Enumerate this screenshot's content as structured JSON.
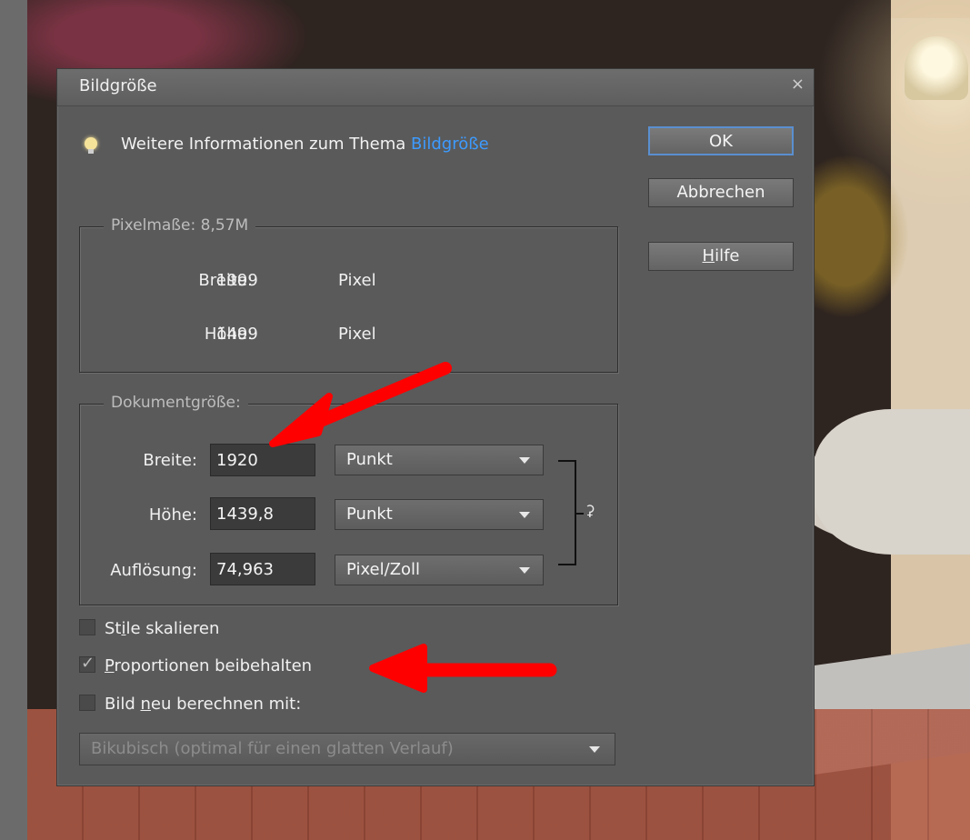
{
  "dialog": {
    "title": "Bildgröße",
    "close_glyph": "×",
    "info_text": "Weitere Informationen zum Thema ",
    "info_link": "Bildgröße",
    "ok_label": "OK",
    "cancel_label": "Abbrechen",
    "help_prefix": "",
    "help_mnemonic": "H",
    "help_rest": "ilfe"
  },
  "pixel_dimensions": {
    "legend": "Pixelmaße: 8,57M",
    "width_label": "Breite:",
    "width_value": "1999",
    "width_unit": "Pixel",
    "height_label": "Höhe:",
    "height_value": "1499",
    "height_unit": "Pixel"
  },
  "document_size": {
    "legend": "Dokumentgröße:",
    "width_label": "Breite:",
    "width_value": "1920",
    "width_unit": "Punkt",
    "height_label": "Höhe:",
    "height_value": "1439,8",
    "height_unit": "Punkt",
    "resolution_label": "Auflösung:",
    "resolution_value": "74,963",
    "resolution_unit": "Pixel/Zoll",
    "link_icon": "chain-link-icon"
  },
  "options": {
    "scale_styles": {
      "pre": "St",
      "mnemonic": "i",
      "post": "le skalieren",
      "checked": false
    },
    "constrain": {
      "pre": "",
      "mnemonic": "P",
      "post": "roportionen beibehalten",
      "checked": true
    },
    "resample": {
      "pre": "Bild ",
      "mnemonic": "n",
      "post": "eu berechnen mit:",
      "checked": false
    },
    "resample_method": "Bikubisch (optimal für einen glatten Verlauf)"
  },
  "colors": {
    "dialog_bg": "#5a5a5a",
    "link_blue": "#3d9bff",
    "annotation_red": "#ff0000"
  }
}
